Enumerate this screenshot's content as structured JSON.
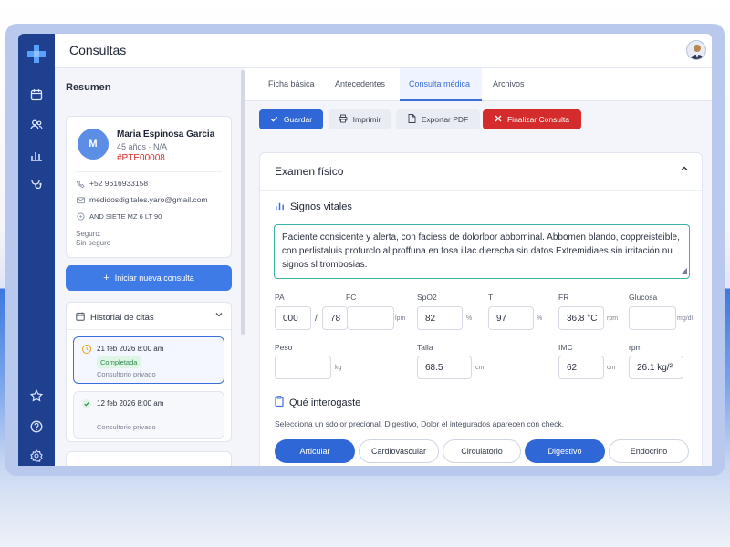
{
  "app": {
    "title": "Consultas"
  },
  "left": {
    "header": "Resumen",
    "patient": {
      "initial": "M",
      "name": "Maria Espinosa Garcia",
      "meta": "45 años · N/A",
      "id": "#PTE00008",
      "phone": "+52 9616933158",
      "email": "medidosdigitales.yaro@gmail.com",
      "address": "AND SIETE MZ 6 LT 90",
      "insurance_label": "Seguro:",
      "insurance_value": "Sin seguro"
    },
    "new_consult_label": "Iniciar nueva consulta",
    "history": {
      "title": "Historial de citas",
      "items": [
        {
          "date": "21 feb 2026 8:00 am",
          "status": "Completada",
          "location": "Consultorio privado"
        },
        {
          "date": "12 feb 2026 8:00 am",
          "location": "Consultorio privado"
        }
      ]
    }
  },
  "tabs": [
    "Ficha básica",
    "Antecedentes",
    "Consulta médica",
    "Archivos"
  ],
  "active_tab": "Consulta médica",
  "toolbar": {
    "save": "Guardar",
    "print": "Imprimir",
    "export": "Exportar PDF",
    "finalize": "Finalizar Consulta"
  },
  "exam": {
    "title": "Examen físico",
    "vitals_title": "Signos vitales",
    "notes": "Paciente consicente y alerta, con faciess de dolorloor abbominal. Abbomen blando, coppreisteible, con perlistaluis profurclo al proffuna en fosa illac dierecha sin datos Extremidiaes sin irritación nu signos sl trombosias.",
    "vitals": {
      "pa_label": "PA",
      "pa_sys": "000",
      "pa_sep": "/",
      "pa_dia": "78",
      "fc_label": "FC",
      "fc_unit": "lpm",
      "spo2_label": "SpO2",
      "spo2_value": "82",
      "spo2_unit": "%",
      "t_label": "T",
      "t_value": "97",
      "t_unit": "%",
      "fr_label": "FR",
      "fr_value": "36.8 °C",
      "fr_unit": "rpm",
      "glucosa_label": "Glucosa",
      "glucosa_unit": "mg/dl",
      "peso_label": "Peso",
      "peso_unit": "kg",
      "talla_label": "Talla",
      "talla_value": "68.5",
      "talla_unit": "cm",
      "imc_label": "IMC",
      "imc_value": "62",
      "imc_unit": "cm",
      "rpm_label": "rpm",
      "rpm_value": "26.1 kg/²"
    },
    "interrogation_title": "Qué interogaste",
    "hint": "Selecciona un sdolor precional. Digestivo, Dolor el integurados aparecen con check.",
    "chips": [
      {
        "label": "Articular",
        "selected": true
      },
      {
        "label": "Cardiovascular",
        "selected": false
      },
      {
        "label": "Circulatorio",
        "selected": false
      },
      {
        "label": "Digestivo",
        "selected": true
      },
      {
        "label": "Endocrino",
        "selected": false
      }
    ]
  },
  "colors": {
    "sidebar": "#1f3f8f",
    "primary": "#2f67d6",
    "danger": "#d42c2c",
    "patient_id": "#d12a2a",
    "notes_border": "#3bb3a8"
  }
}
